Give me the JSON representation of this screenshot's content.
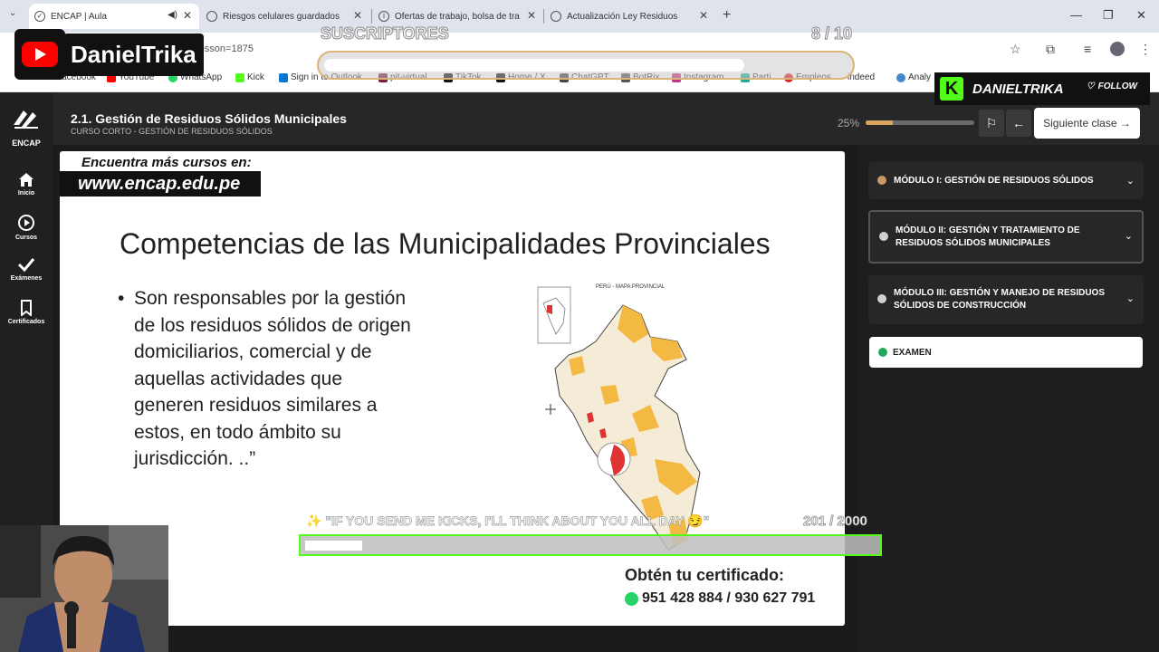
{
  "browser": {
    "tabs": [
      {
        "title": "ENCAP | Aula",
        "active": true
      },
      {
        "title": "Riesgos celulares guardados",
        "active": false
      },
      {
        "title": "Ofertas de trabajo, bolsa de tra",
        "active": false
      },
      {
        "title": "Actualización Ley Residuos",
        "active": false
      }
    ],
    "url": "/course/50460/178?lesson=1875",
    "bookmarks": [
      "Facebook",
      "YouTube",
      "WhatsApp",
      "Kick",
      "Sign in to Outlook",
      "pit-virtual",
      "TikTok",
      "Home / X",
      "ChatGPT",
      "BotRix",
      "Instagram",
      "Parti",
      "Empleos",
      "indeed",
      "Analy"
    ]
  },
  "app": {
    "brand": "ENCAP",
    "nav": [
      {
        "label": "Inicio",
        "icon": "home-icon"
      },
      {
        "label": "Cursos",
        "icon": "play-circle-icon"
      },
      {
        "label": "Exámenes",
        "icon": "check-icon"
      },
      {
        "label": "Certificados",
        "icon": "bookmark-icon"
      }
    ],
    "lesson_title": "2.1. Gestión de Residuos Sólidos Municipales",
    "lesson_subtitle": "CURSO CORTO - GESTIÓN DE RESIDUOS SÓLIDOS",
    "progress_label": "25%",
    "progress_value": 0.25,
    "next_label": "Siguiente clase"
  },
  "slide": {
    "promo_top": "Encuentra más cursos en:",
    "promo_site": "www.encap.edu.pe",
    "title": "Competencias de las Municipalidades Provinciales",
    "bullet": "Son  responsables por la gestión\nde los residuos sólidos de origen\ndomiciliarios, comercial y de\naquellas actividades que\ngeneren residuos similares a\nestos, en todo ámbito su\njurisdicción. ..”",
    "map_caption": "PERÚ - MAPA PROVINCIAL",
    "cert_title": "Obtén tu certificado:",
    "cert_phone": "951 428 884 / 930 627 791"
  },
  "modules": [
    {
      "label": "MÓDULO I: GESTIÓN DE RESIDUOS SÓLIDOS",
      "status_color": "#c89a62"
    },
    {
      "label": "MÓDULO II: GESTIÓN Y TRATAMIENTO DE RESIDUOS SÓLIDOS MUNICIPALES",
      "status_color": "#d0d0d0"
    },
    {
      "label": "MÓDULO III: GESTIÓN Y MANEJO DE RESIDUOS SÓLIDOS DE CONSTRUCCIÓN",
      "status_color": "#d0d0d0"
    }
  ],
  "exam_label": "EXAMEN",
  "overlay": {
    "yt_name": "DanielTrika",
    "subs_label": "SUSCRIPTORES",
    "subs_count": "8 / 10",
    "subs_progress": 0.8,
    "kick_name": "DANIELTRIKA",
    "kick_follow": "FOLLOW",
    "goal_text": "✨ \"IF YOU SEND ME KICKS, I'LL THINK ABOUT YOU ALL DAY 😏\"",
    "goal_count": "201  / 2000",
    "goal_progress": 0.1
  },
  "colors": {
    "accent": "#d9a460",
    "kick_green": "#53fc18",
    "yt_red": "#ff0000"
  }
}
